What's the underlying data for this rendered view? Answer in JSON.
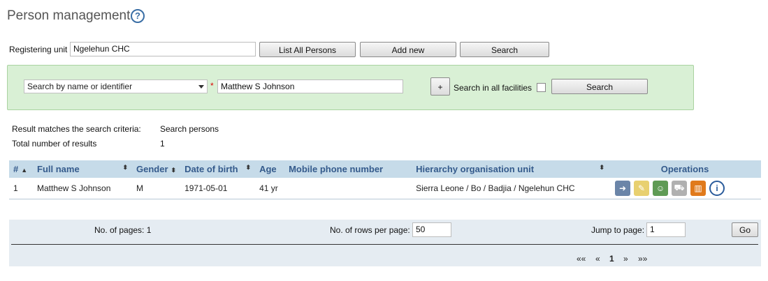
{
  "page": {
    "title": "Person management",
    "help_icon": "help-icon"
  },
  "toolbar": {
    "registering_unit_label": "Registering unit",
    "registering_unit_value": "Ngelehun CHC",
    "list_all_label": "List All Persons",
    "add_new_label": "Add new",
    "search_label": "Search"
  },
  "search_panel": {
    "search_by_selected": "Search by name or identifier",
    "required_mark": "*",
    "search_value": "Matthew S Johnson",
    "plus_label": "+",
    "all_facilities_label": "Search in all facilities",
    "all_facilities_checked": false,
    "search_button_label": "Search",
    "background_color": "#d9f0d5"
  },
  "results_summary": {
    "criteria_label": "Result matches the search criteria:",
    "criteria_value": "Search persons",
    "total_label": "Total number of results",
    "total_value": "1"
  },
  "table": {
    "headers": [
      "#",
      "Full name",
      "Gender",
      "Date of birth",
      "Age",
      "Mobile phone number",
      "Hierarchy organisation unit",
      "Operations"
    ],
    "rows": [
      {
        "index": "1",
        "full_name": "Matthew S Johnson",
        "gender": "M",
        "dob": "1971-05-01",
        "age": "41 yr",
        "mobile": "",
        "org_unit": "Sierra Leone / Bo / Badjia / Ngelehun CHC",
        "operations": [
          "enroll-icon",
          "edit-icon",
          "relationship-icon",
          "transfer-icon",
          "delete-icon",
          "info-icon"
        ]
      }
    ],
    "header_color": "#c6dbe9"
  },
  "pager": {
    "pages_label": "No. of pages: 1",
    "rows_per_page_label": "No. of rows per page:",
    "rows_per_page_value": "50",
    "jump_label": "Jump to page:",
    "jump_value": "1",
    "go_label": "Go",
    "first": "««",
    "prev": "«",
    "current": "1",
    "next": "»",
    "last": "»»"
  }
}
